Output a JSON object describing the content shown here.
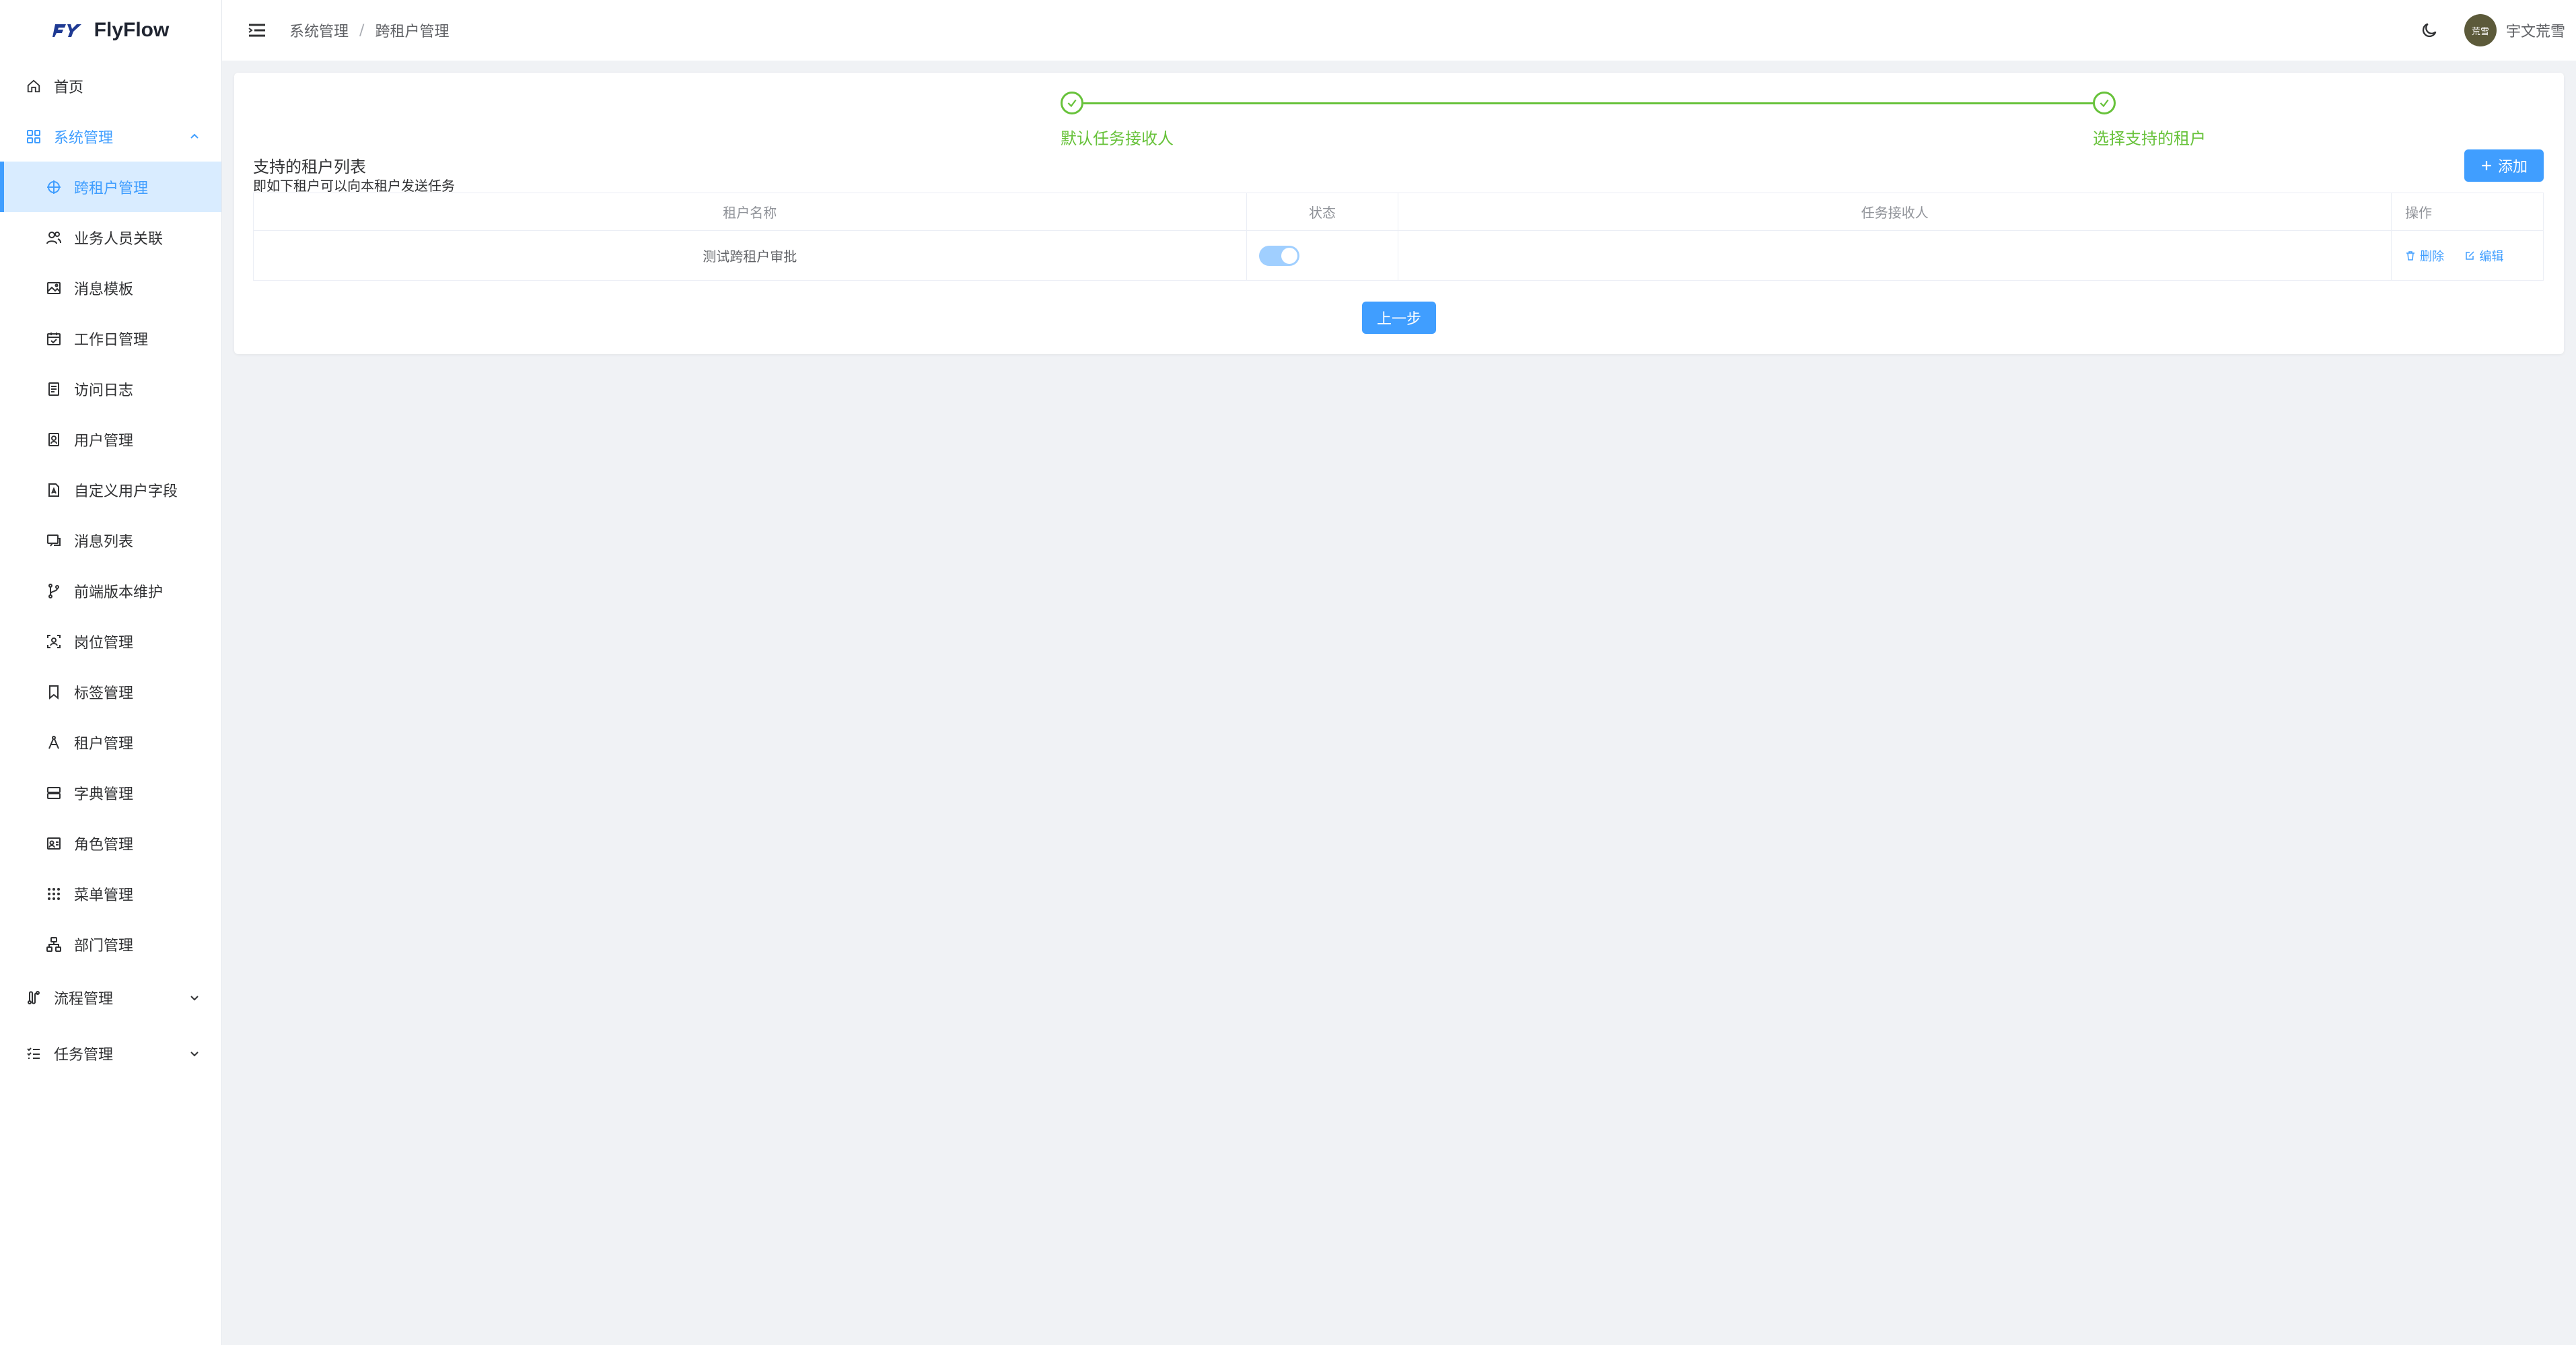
{
  "app": {
    "name": "FlyFlow"
  },
  "sidebar": {
    "items": [
      {
        "label": "首页",
        "icon": "home-icon"
      },
      {
        "label": "系统管理",
        "icon": "grid-icon",
        "open": true
      },
      {
        "label": "跨租户管理",
        "icon": "crosshair-icon",
        "active": true
      },
      {
        "label": "业务人员关联",
        "icon": "users-icon"
      },
      {
        "label": "消息模板",
        "icon": "image-icon"
      },
      {
        "label": "工作日管理",
        "icon": "calendar-icon"
      },
      {
        "label": "访问日志",
        "icon": "document-icon"
      },
      {
        "label": "用户管理",
        "icon": "user-card-icon"
      },
      {
        "label": "自定义用户字段",
        "icon": "file-edit-icon"
      },
      {
        "label": "消息列表",
        "icon": "message-icon"
      },
      {
        "label": "前端版本维护",
        "icon": "branch-icon"
      },
      {
        "label": "岗位管理",
        "icon": "focus-user-icon"
      },
      {
        "label": "标签管理",
        "icon": "bookmark-icon"
      },
      {
        "label": "租户管理",
        "icon": "compass-icon"
      },
      {
        "label": "字典管理",
        "icon": "server-icon"
      },
      {
        "label": "角色管理",
        "icon": "role-icon"
      },
      {
        "label": "菜单管理",
        "icon": "dots-grid-icon"
      },
      {
        "label": "部门管理",
        "icon": "org-chart-icon"
      },
      {
        "label": "流程管理",
        "icon": "flow-icon"
      },
      {
        "label": "任务管理",
        "icon": "task-list-icon"
      }
    ]
  },
  "header": {
    "breadcrumb": [
      "系统管理",
      "跨租户管理"
    ],
    "breadcrumb_sep": "/",
    "avatar_text": "荒雪",
    "username": "宇文荒雪"
  },
  "steps": [
    {
      "label": "默认任务接收人",
      "status": "finish"
    },
    {
      "label": "选择支持的租户",
      "status": "finish"
    }
  ],
  "section": {
    "title": "支持的租户列表",
    "desc": "即如下租户可以向本租户发送任务",
    "add_label": "添加"
  },
  "table": {
    "headers": [
      "租户名称",
      "状态",
      "任务接收人",
      "操作"
    ],
    "rows": [
      {
        "name": "测试跨租户审批",
        "status_on": true,
        "receiver": "",
        "delete": "删除",
        "edit": "编辑"
      }
    ]
  },
  "footer": {
    "prev_label": "上一步"
  },
  "colors": {
    "primary": "#409eff",
    "success": "#67c23a",
    "active_bg": "#d9ecff"
  }
}
